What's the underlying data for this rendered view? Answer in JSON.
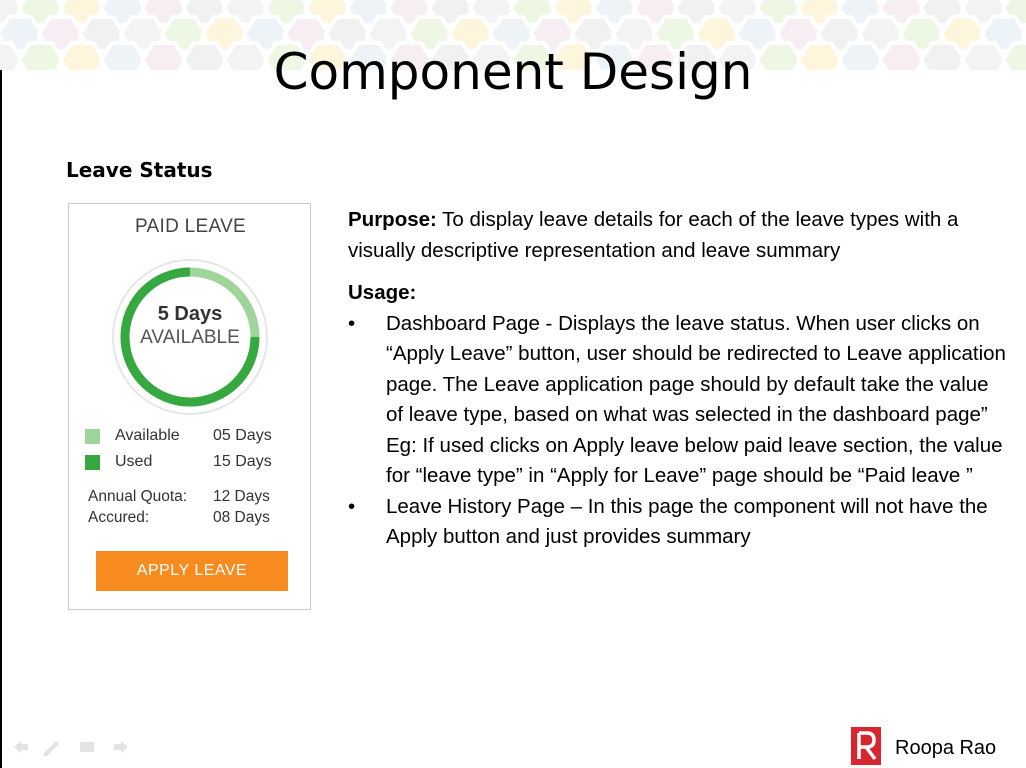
{
  "slide": {
    "title": "Component Design",
    "section_heading": "Leave Status"
  },
  "card": {
    "title": "PAID LEAVE",
    "days": "5 Days",
    "available_label": "AVAILABLE",
    "legend": [
      {
        "label": "Available",
        "value": "05 Days",
        "color": "#9fd59a"
      },
      {
        "label": "Used",
        "value": "15 Days",
        "color": "#35a83f"
      }
    ],
    "quota": [
      {
        "label": "Annual Quota:",
        "value": "12 Days"
      },
      {
        "label": "Accured:",
        "value": "08 Days"
      }
    ],
    "apply_label": "APPLY LEAVE",
    "donut": {
      "used_fraction": 0.75,
      "used_color": "#35a83f",
      "available_color": "#9fd59a"
    }
  },
  "text": {
    "purpose_label": "Purpose:",
    "purpose_text": " To display leave details for each of the leave types with a visually descriptive representation and leave summary",
    "usage_heading": "Usage:",
    "bullets": [
      {
        "line1": "Dashboard Page  - Displays the leave status. When user clicks on “Apply Leave” button, user should be redirected to Leave application page. The Leave application page should by default take the value of leave type, based on what was selected in the dashboard page”",
        "line2": "Eg: If used clicks on Apply leave below paid leave section, the value for “leave type” in “Apply for Leave” page should be  “Paid leave ”"
      },
      {
        "line1": "Leave History Page – In this page the component will not have the  Apply button and just provides summary"
      }
    ]
  },
  "footer": {
    "author": "Roopa Rao",
    "logo_color": "#d7262e"
  }
}
